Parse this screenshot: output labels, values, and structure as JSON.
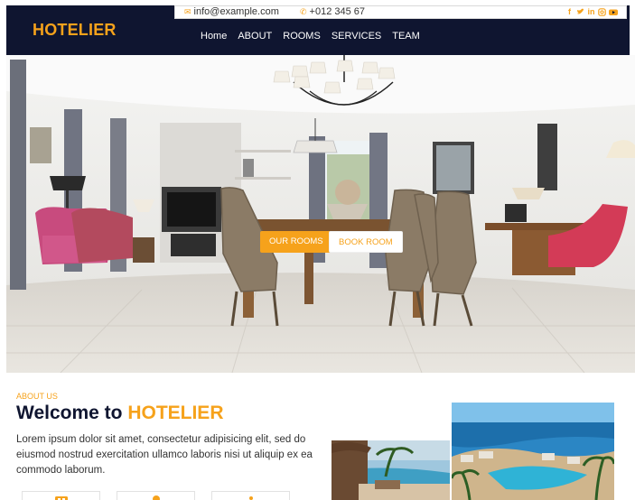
{
  "header": {
    "brand": "HOTELIER",
    "email": "info@example.com",
    "phone": "+012 345 67",
    "nav": [
      "Home",
      "ABOUT",
      "ROOMS",
      "SERVICES",
      "TEAM"
    ],
    "socials": [
      "facebook-icon",
      "twitter-icon",
      "linkedin-icon",
      "instagram-icon",
      "youtube-icon"
    ]
  },
  "hero": {
    "btn_rooms": "OUR ROOMS",
    "btn_book": "BOOK ROOM"
  },
  "about": {
    "tag": "ABOUT US",
    "title_prefix": "Welcome to",
    "title_highlight": "HOTELIER",
    "text": "Lorem ipsum dolor sit amet, consectetur adipisicing elit, sed do eiusmod nostrud exercitation ullamco laboris nisi ut aliquip ex ea commodo laborum."
  },
  "colors": {
    "accent": "#f6a21b",
    "navy": "#0f1530"
  }
}
